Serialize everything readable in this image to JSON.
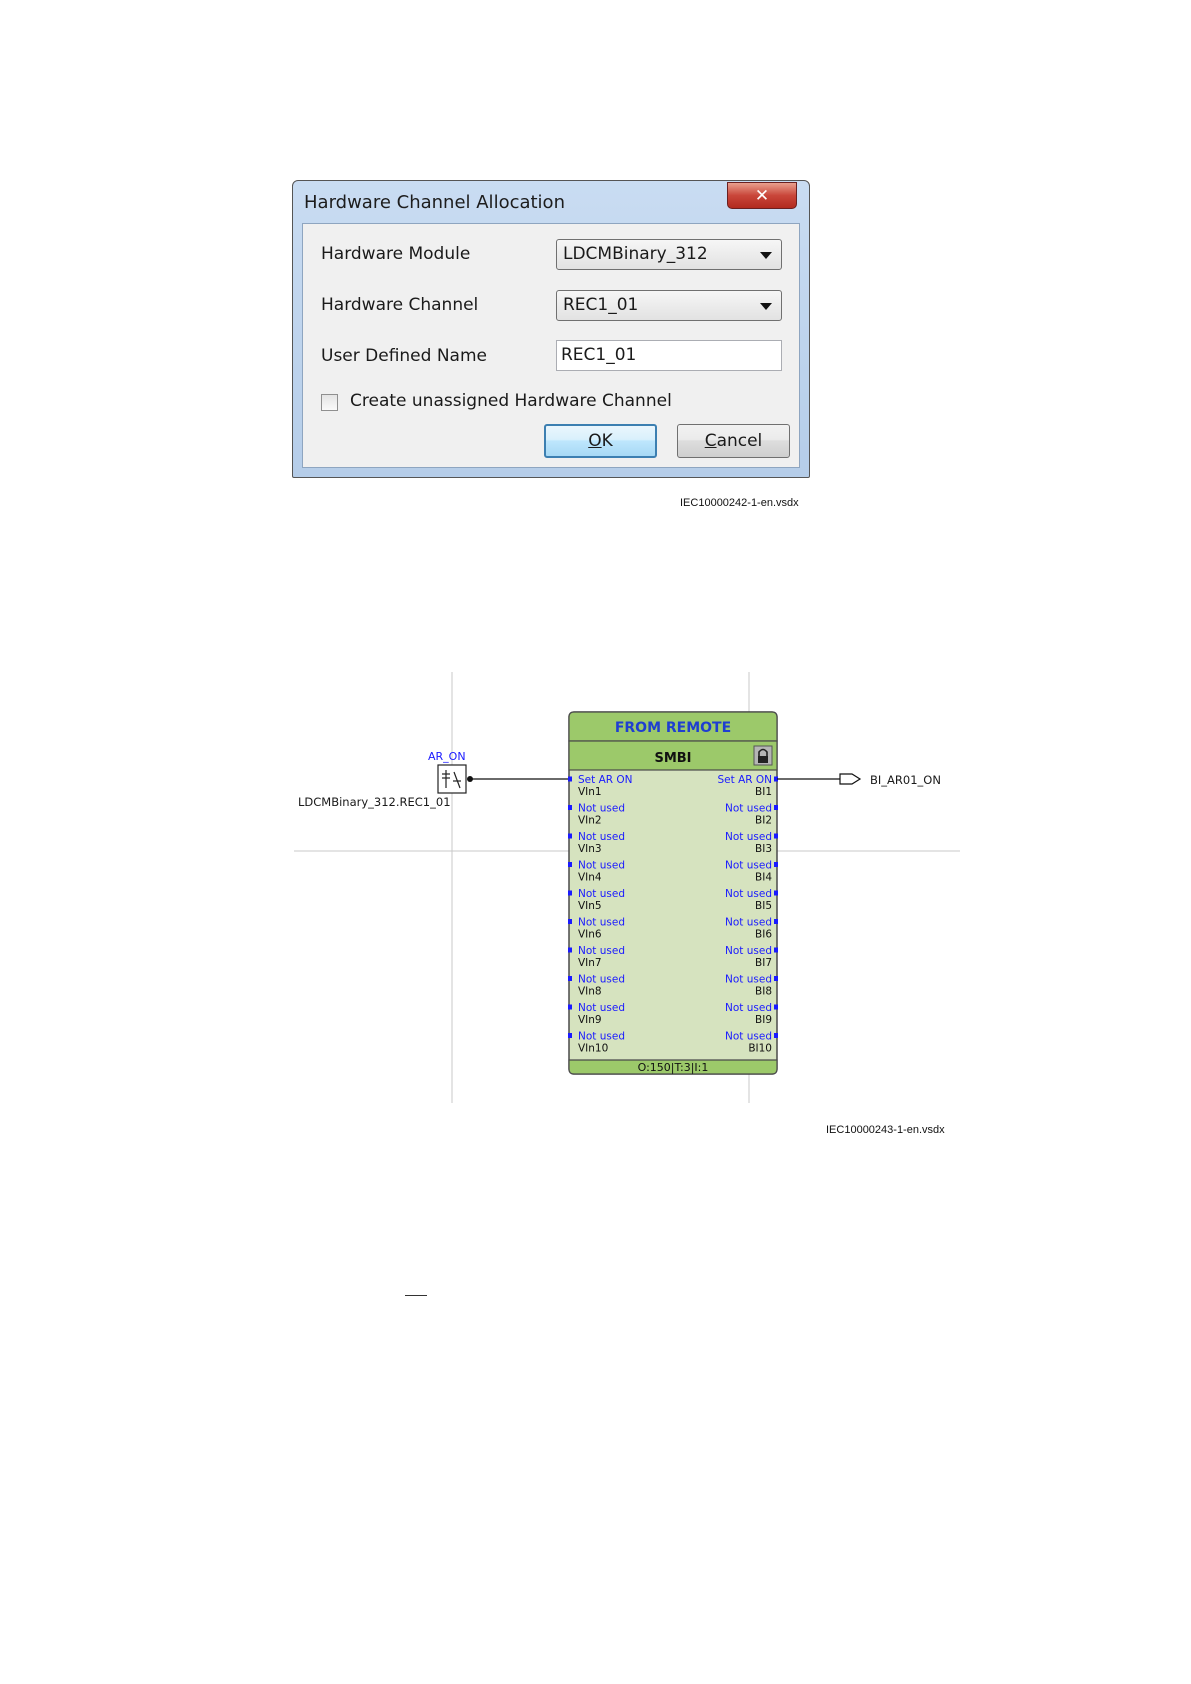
{
  "dialog": {
    "title": "Hardware Channel Allocation",
    "close_glyph": "✕",
    "hardware_module": {
      "label": "Hardware Module",
      "value": "LDCMBinary_312"
    },
    "hardware_channel": {
      "label": "Hardware Channel",
      "value": "REC1_01"
    },
    "user_defined_name": {
      "label": "User Defined Name",
      "value": "REC1_01"
    },
    "create_unassigned": {
      "label": "Create unassigned Hardware Channel",
      "checked": false
    },
    "ok_label_key": "O",
    "ok_label_rest": "K",
    "cancel_label_key": "C",
    "cancel_label_rest": "ancel"
  },
  "caption1": "IEC10000242-1-en.vsdx",
  "diagram": {
    "block_title": "FROM REMOTE",
    "block_name": "SMBI",
    "input_signal_name": "AR_ON",
    "input_source": "LDCMBinary_312.REC1_01",
    "output_signal": "BI_AR01_ON",
    "footer": "O:150|T:3|I:1",
    "inputs": [
      {
        "label": "Set AR ON",
        "pin": "VIn1"
      },
      {
        "label": "Not used",
        "pin": "VIn2"
      },
      {
        "label": "Not used",
        "pin": "VIn3"
      },
      {
        "label": "Not used",
        "pin": "VIn4"
      },
      {
        "label": "Not used",
        "pin": "VIn5"
      },
      {
        "label": "Not used",
        "pin": "VIn6"
      },
      {
        "label": "Not used",
        "pin": "VIn7"
      },
      {
        "label": "Not used",
        "pin": "VIn8"
      },
      {
        "label": "Not used",
        "pin": "VIn9"
      },
      {
        "label": "Not used",
        "pin": "VIn10"
      }
    ],
    "outputs": [
      {
        "label": "Set AR ON",
        "pin": "BI1"
      },
      {
        "label": "Not used",
        "pin": "BI2"
      },
      {
        "label": "Not used",
        "pin": "BI3"
      },
      {
        "label": "Not used",
        "pin": "BI4"
      },
      {
        "label": "Not used",
        "pin": "BI5"
      },
      {
        "label": "Not used",
        "pin": "BI6"
      },
      {
        "label": "Not used",
        "pin": "BI7"
      },
      {
        "label": "Not used",
        "pin": "BI8"
      },
      {
        "label": "Not used",
        "pin": "BI9"
      },
      {
        "label": "Not used",
        "pin": "BI10"
      }
    ],
    "colors": {
      "block_fill": "#d6e3bf",
      "header_fill": "#9cc96a",
      "pin_label": "#1a1aff",
      "grid": "#c8c8c8"
    }
  },
  "caption2": "IEC10000243-1-en.vsdx"
}
